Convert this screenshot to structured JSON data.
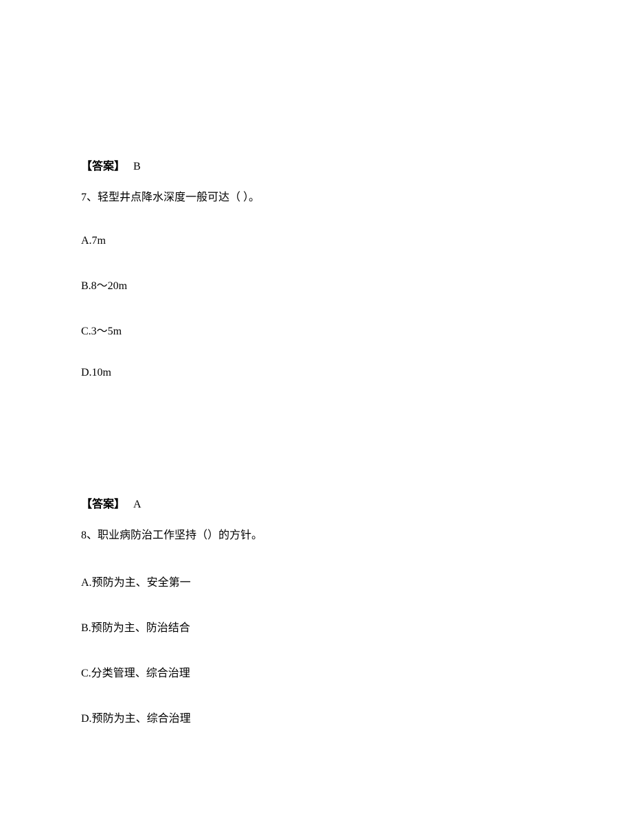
{
  "q6": {
    "answer_label": "【答案】",
    "answer_value": "B"
  },
  "q7": {
    "number": "7、",
    "stem_prefix": "轻",
    "stem": "型井点降水深度一般可达（  ）。",
    "options": {
      "a": "A.7m",
      "b": "B.8～20m",
      "c": "C.3～5m",
      "d": "D.10m"
    },
    "answer_label": "【答案】",
    "answer_value": "A"
  },
  "q8": {
    "number": "8、",
    "stem_prefix": "职业",
    "stem": "病防治工作坚持（）的方针。",
    "options": {
      "a_prefix": "A.",
      "a_text": "预",
      "a_rest": "防为主、安全第一",
      "b_prefix": "B.",
      "b_text": "预",
      "b_rest": "防为主、防治结合",
      "c_prefix": "C.",
      "c_text": "分类",
      "c_rest": "管理、综合治理",
      "d_prefix": "D.",
      "d_text": "预",
      "d_rest": "防为主、综合治理"
    }
  }
}
